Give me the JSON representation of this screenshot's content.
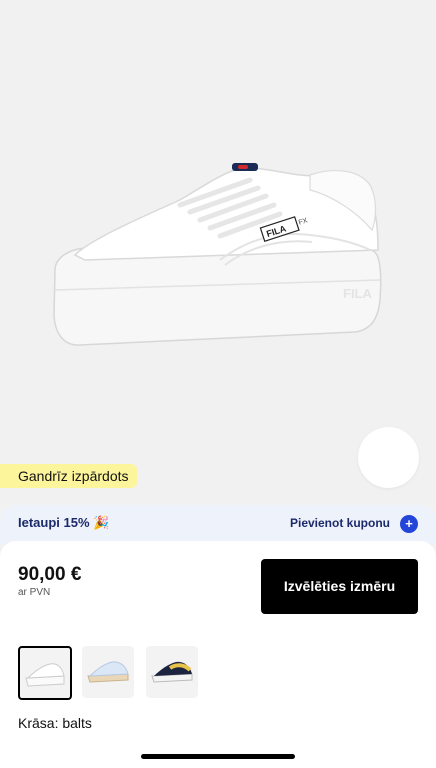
{
  "product": {
    "image_alt": "FILA FX sneaker",
    "logo_text": "FILA",
    "model_text": "FX"
  },
  "badge": {
    "text": "Gandrīz izpārdots"
  },
  "coupon": {
    "save_text": "Ietaupi 15% 🎉",
    "add_label": "Pievienot kuponu",
    "plus_icon": "plus-icon"
  },
  "pricing": {
    "price": "90,00 €",
    "vat_note": "ar PVN"
  },
  "actions": {
    "choose_size_label": "Izvēlēties izmēru"
  },
  "thumbnails": [
    {
      "name": "white sneaker",
      "selected": true
    },
    {
      "name": "light blue sneaker",
      "selected": false
    },
    {
      "name": "navy yellow sneaker",
      "selected": false
    }
  ],
  "color": {
    "label": "Krāsa: balts"
  },
  "colors": {
    "badge_bg": "#fcf59c",
    "accent": "#2346d8",
    "cta_bg": "#000000",
    "coupon_text": "#1c2a6b"
  }
}
